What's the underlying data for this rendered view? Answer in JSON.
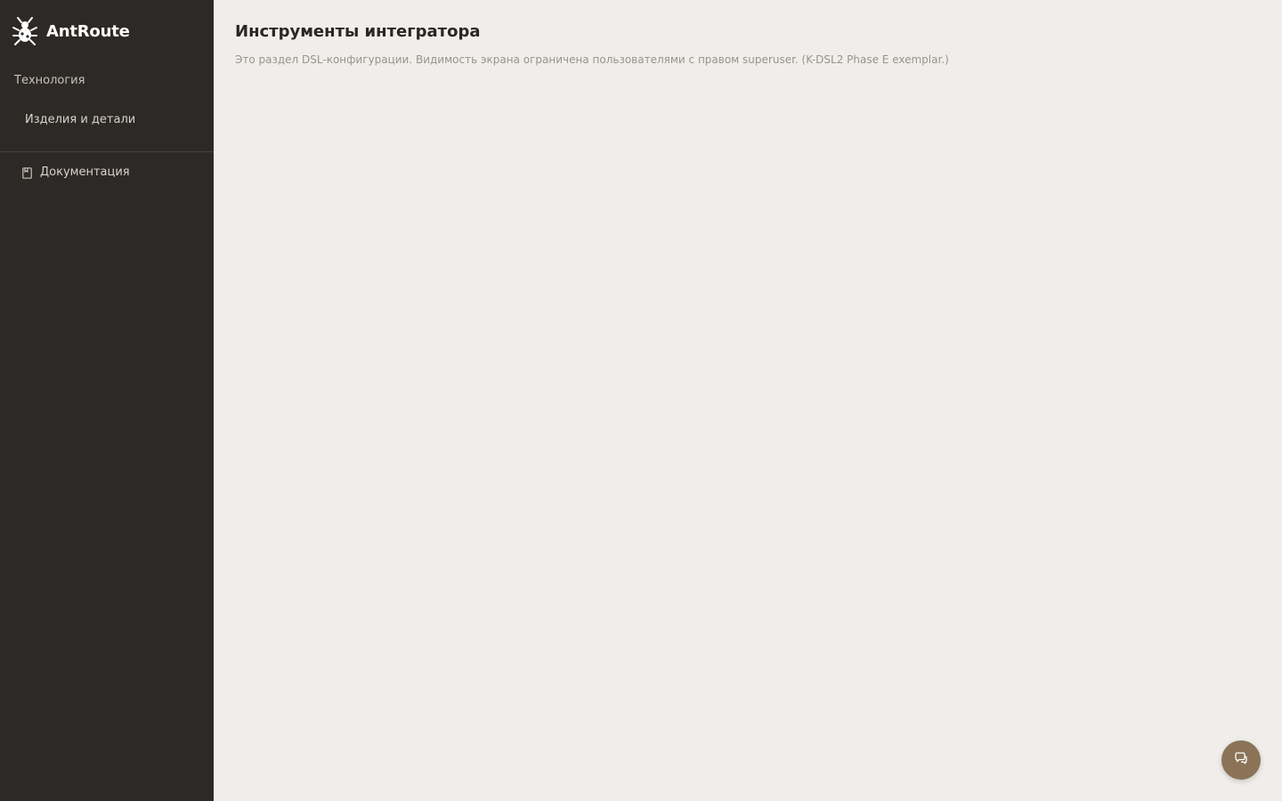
{
  "brand": {
    "name": "AntRoute",
    "logo_icon": "ant-logo-icon"
  },
  "sidebar": {
    "section_label": "Технология",
    "items": [
      {
        "label": "Изделия и детали"
      }
    ],
    "docs": {
      "label": "Документация",
      "icon": "book-icon"
    }
  },
  "main": {
    "title": "Инструменты интегратора",
    "description": "Это раздел DSL-конфигурации. Видимость экрана ограничена пользователями с правом superuser. (K-DSL2 Phase E exemplar.)"
  },
  "chat": {
    "icon": "chat-bubble-icon"
  },
  "colors": {
    "sidebar_bg": "#2d2926",
    "main_bg": "#efeeea",
    "accent": "#8b7358"
  }
}
